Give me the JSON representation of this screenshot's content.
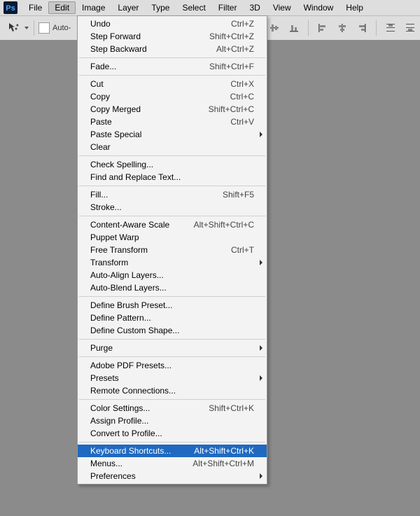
{
  "app": {
    "logo_text": "Ps"
  },
  "menubar": {
    "items": [
      {
        "label": "File",
        "active": false
      },
      {
        "label": "Edit",
        "active": true
      },
      {
        "label": "Image",
        "active": false
      },
      {
        "label": "Layer",
        "active": false
      },
      {
        "label": "Type",
        "active": false
      },
      {
        "label": "Select",
        "active": false
      },
      {
        "label": "Filter",
        "active": false
      },
      {
        "label": "3D",
        "active": false
      },
      {
        "label": "View",
        "active": false
      },
      {
        "label": "Window",
        "active": false
      },
      {
        "label": "Help",
        "active": false
      }
    ]
  },
  "toolbar": {
    "auto_checkbox_label": "Auto-"
  },
  "edit_menu": {
    "items": [
      {
        "label": "Undo",
        "accel": "Ctrl+Z"
      },
      {
        "label": "Step Forward",
        "accel": "Shift+Ctrl+Z"
      },
      {
        "label": "Step Backward",
        "accel": "Alt+Ctrl+Z"
      },
      {
        "sep": true
      },
      {
        "label": "Fade...",
        "accel": "Shift+Ctrl+F"
      },
      {
        "sep": true
      },
      {
        "label": "Cut",
        "accel": "Ctrl+X"
      },
      {
        "label": "Copy",
        "accel": "Ctrl+C"
      },
      {
        "label": "Copy Merged",
        "accel": "Shift+Ctrl+C"
      },
      {
        "label": "Paste",
        "accel": "Ctrl+V"
      },
      {
        "label": "Paste Special",
        "submenu": true
      },
      {
        "label": "Clear"
      },
      {
        "sep": true
      },
      {
        "label": "Check Spelling..."
      },
      {
        "label": "Find and Replace Text..."
      },
      {
        "sep": true
      },
      {
        "label": "Fill...",
        "accel": "Shift+F5"
      },
      {
        "label": "Stroke..."
      },
      {
        "sep": true
      },
      {
        "label": "Content-Aware Scale",
        "accel": "Alt+Shift+Ctrl+C"
      },
      {
        "label": "Puppet Warp"
      },
      {
        "label": "Free Transform",
        "accel": "Ctrl+T"
      },
      {
        "label": "Transform",
        "submenu": true
      },
      {
        "label": "Auto-Align Layers..."
      },
      {
        "label": "Auto-Blend Layers..."
      },
      {
        "sep": true
      },
      {
        "label": "Define Brush Preset..."
      },
      {
        "label": "Define Pattern..."
      },
      {
        "label": "Define Custom Shape..."
      },
      {
        "sep": true
      },
      {
        "label": "Purge",
        "submenu": true
      },
      {
        "sep": true
      },
      {
        "label": "Adobe PDF Presets..."
      },
      {
        "label": "Presets",
        "submenu": true
      },
      {
        "label": "Remote Connections..."
      },
      {
        "sep": true
      },
      {
        "label": "Color Settings...",
        "accel": "Shift+Ctrl+K"
      },
      {
        "label": "Assign Profile..."
      },
      {
        "label": "Convert to Profile..."
      },
      {
        "sep": true
      },
      {
        "label": "Keyboard Shortcuts...",
        "accel": "Alt+Shift+Ctrl+K",
        "highlight": true
      },
      {
        "label": "Menus...",
        "accel": "Alt+Shift+Ctrl+M"
      },
      {
        "label": "Preferences",
        "submenu": true
      }
    ]
  }
}
